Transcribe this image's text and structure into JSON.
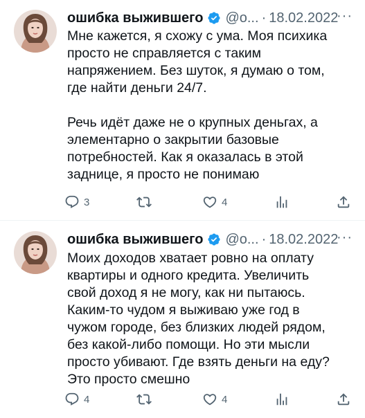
{
  "tweets": [
    {
      "author_name": "ошибка выжившего",
      "handle": "@o...",
      "separator": "·",
      "date": "18.02.2022",
      "more": "···",
      "paragraphs": [
        "Мне кажется, я схожу с ума. Моя психика\nпросто не справляется с таким\nнапряжением. Без шуток, я думаю о том,\nгде найти деньги 24/7.",
        "Речь идёт даже не о крупных деньгах, а\nэлементарно о закрытии базовые\nпотребностей. Как я оказалась в этой\nзаднице, я просто не понимаю"
      ],
      "replies": "3",
      "retweets": "",
      "likes": "4"
    },
    {
      "author_name": "ошибка выжившего",
      "handle": "@o...",
      "separator": "·",
      "date": "18.02.2022",
      "more": "···",
      "paragraphs": [
        "Моих доходов хватает ровно на оплату\nквартиры и одного кредита. Увеличить\nсвой доход я не могу, как ни пытаюсь.\nКаким-то чудом я выживаю уже год в\nчужом городе, без близких людей рядом,\nбез какой-либо помощи. Но эти мысли\nпросто убивают. Где взять деньги на еду?\nЭто просто смешно"
      ],
      "replies": "4",
      "retweets": "",
      "likes": "4"
    }
  ],
  "colors": {
    "text": "#0f1419",
    "secondary": "#536471",
    "verified": "#1d9bf0",
    "divider": "#eff3f4"
  },
  "icons": {
    "reply": "reply-icon",
    "retweet": "retweet-icon",
    "like": "heart-icon",
    "views": "views-icon",
    "share": "share-icon",
    "verified": "verified-badge-icon"
  }
}
